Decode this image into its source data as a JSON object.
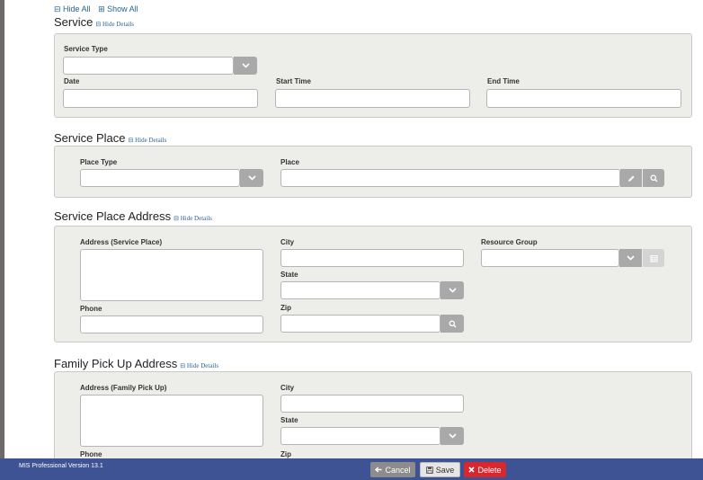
{
  "top_links": {
    "hide_all": "⊟ Hide All",
    "show_all": "⊞ Show All"
  },
  "hide_details": "⊟ Hide Details",
  "service": {
    "title": "Service",
    "service_type_label": "Service Type",
    "date_label": "Date",
    "start_time_label": "Start Time",
    "end_time_label": "End Time"
  },
  "service_place": {
    "title": "Service Place",
    "place_type_label": "Place Type",
    "place_label": "Place"
  },
  "service_place_address": {
    "title": "Service Place Address",
    "address_label": "Address (Service Place)",
    "city_label": "City",
    "state_label": "State",
    "zip_label": "Zip",
    "phone_label": "Phone",
    "resource_group_label": "Resource Group"
  },
  "family_pickup": {
    "title": "Family Pick Up Address",
    "address_label": "Address (Family Pick Up)",
    "city_label": "City",
    "state_label": "State",
    "phone_label": "Phone",
    "zip_label": "Zip"
  },
  "footer": {
    "version": "MIS Professional Version 13.1",
    "cancel": "Cancel",
    "save": "Save",
    "delete": "Delete"
  },
  "colors": {
    "footer_bg": "#3d5394",
    "cancel_bg": "#8c8c8c",
    "save_bg": "#e6e6e6",
    "delete_bg": "#d9272e",
    "link": "#2a6496"
  }
}
